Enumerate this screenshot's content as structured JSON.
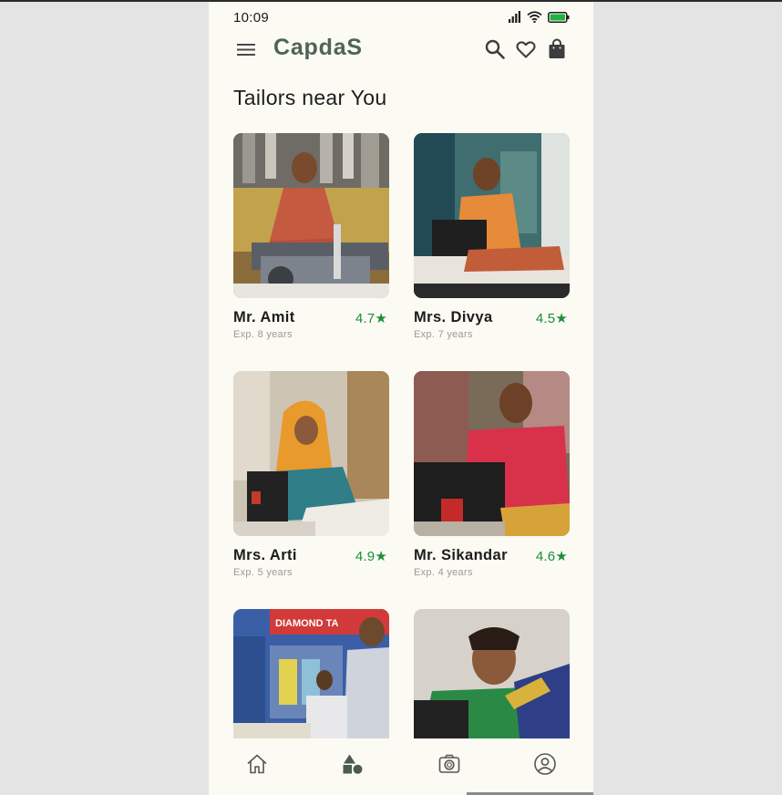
{
  "status_bar": {
    "time": "10:09"
  },
  "app": {
    "title": "CapdaS"
  },
  "section": {
    "title": "Tailors near You"
  },
  "tailors": [
    {
      "name": "Mr. Amit",
      "rating": "4.7★",
      "experience": "Exp. 8 years"
    },
    {
      "name": "Mrs. Divya",
      "rating": "4.5★",
      "experience": "Exp. 7 years"
    },
    {
      "name": "Mrs. Arti",
      "rating": "4.9★",
      "experience": "Exp. 5 years"
    },
    {
      "name": "Mr. Sikandar",
      "rating": "4.6★",
      "experience": "Exp. 4 years"
    }
  ],
  "partial_cards": [
    {
      "photo_sign": "DIAMOND TA"
    }
  ],
  "bottom_nav": [
    "home-icon",
    "categories-icon",
    "camera-icon",
    "profile-icon"
  ],
  "colors": {
    "brand": "#4d6455",
    "rating": "#1b8f3c",
    "background": "#fbfaf3"
  }
}
